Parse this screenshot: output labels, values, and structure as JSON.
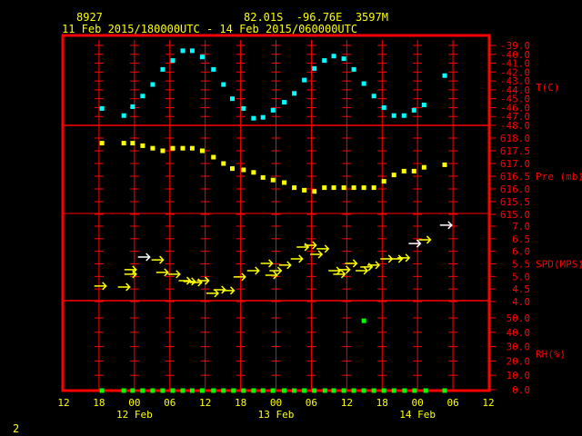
{
  "header": {
    "station_id": "8927",
    "location": "82.01S  -96.76E  3597M",
    "time_range": "11 Feb 2015/180000UTC - 14 Feb 2015/060000UTC"
  },
  "footer_number": "2",
  "colors": {
    "frame": "#ff0000",
    "temperature": "#00ffff",
    "pressure": "#ffff00",
    "wind": "#ffff00",
    "wind_alt": "#ffffff",
    "rh": "#00ff00",
    "text": "#ffff00"
  },
  "chart_data": {
    "type": "scatter",
    "title": "8927 82.01S -96.76E 3597M",
    "time_axis": {
      "unit": "hours since 11 Feb 2015 12UTC",
      "range": [
        0,
        72
      ],
      "tick_hours": [
        0,
        6,
        12,
        18,
        24,
        30,
        36,
        42,
        48,
        54,
        60,
        66,
        72
      ],
      "tick_labels": [
        "12",
        "18",
        "00",
        "06",
        "12",
        "18",
        "00",
        "06",
        "12",
        "18",
        "00",
        "06",
        "12"
      ],
      "day_labels": [
        {
          "hour": 12,
          "label": "12 Feb"
        },
        {
          "hour": 36,
          "label": "13 Feb"
        },
        {
          "hour": 60,
          "label": "14 Feb"
        }
      ]
    },
    "panels": [
      {
        "name": "temperature",
        "label": "T(C)",
        "range": [
          -48,
          -39
        ],
        "ticks": [
          "-39.0",
          "-40.0",
          "-41.0",
          "-42.0",
          "-43.0",
          "-44.0",
          "-45.0",
          "-46.0",
          "-47.0",
          "-48.0"
        ],
        "tick_values": [
          -39,
          -40,
          -41,
          -42,
          -43,
          -44,
          -45,
          -46,
          -47,
          -48
        ],
        "points": [
          [
            6.5,
            -46.1
          ],
          [
            10.2,
            -46.9
          ],
          [
            11.7,
            -45.9
          ],
          [
            13.4,
            -44.7
          ],
          [
            15.1,
            -43.4
          ],
          [
            16.8,
            -41.7
          ],
          [
            18.5,
            -40.7
          ],
          [
            20.2,
            -39.6
          ],
          [
            21.8,
            -39.6
          ],
          [
            23.5,
            -40.3
          ],
          [
            25.4,
            -41.7
          ],
          [
            27.1,
            -43.4
          ],
          [
            28.6,
            -45.0
          ],
          [
            30.5,
            -46.1
          ],
          [
            32.2,
            -47.2
          ],
          [
            33.8,
            -47.1
          ],
          [
            35.5,
            -46.3
          ],
          [
            37.4,
            -45.4
          ],
          [
            39.1,
            -44.4
          ],
          [
            40.8,
            -42.9
          ],
          [
            42.5,
            -41.6
          ],
          [
            44.2,
            -40.7
          ],
          [
            45.8,
            -40.2
          ],
          [
            47.5,
            -40.5
          ],
          [
            49.2,
            -41.7
          ],
          [
            50.9,
            -43.3
          ],
          [
            52.6,
            -44.7
          ],
          [
            54.3,
            -46.0
          ],
          [
            56.0,
            -46.9
          ],
          [
            57.7,
            -46.9
          ],
          [
            59.4,
            -46.3
          ],
          [
            61.1,
            -45.7
          ],
          [
            64.6,
            -42.4
          ]
        ]
      },
      {
        "name": "pressure",
        "label": "Pre (mb)",
        "range": [
          615,
          618
        ],
        "ticks": [
          "618.0",
          "617.5",
          "617.0",
          "616.5",
          "616.0",
          "615.5",
          "615.0"
        ],
        "tick_values": [
          618,
          617.5,
          617,
          616.5,
          616,
          615.5,
          615
        ],
        "points": [
          [
            6.5,
            617.8
          ],
          [
            10.2,
            617.8
          ],
          [
            11.7,
            617.8
          ],
          [
            13.4,
            617.7
          ],
          [
            15.1,
            617.6
          ],
          [
            16.8,
            617.5
          ],
          [
            18.5,
            617.6
          ],
          [
            20.2,
            617.6
          ],
          [
            21.8,
            617.6
          ],
          [
            23.5,
            617.5
          ],
          [
            25.4,
            617.25
          ],
          [
            27.1,
            617.0
          ],
          [
            28.6,
            616.8
          ],
          [
            30.5,
            616.75
          ],
          [
            32.2,
            616.65
          ],
          [
            33.8,
            616.45
          ],
          [
            35.5,
            616.35
          ],
          [
            37.4,
            616.25
          ],
          [
            39.1,
            616.05
          ],
          [
            40.8,
            615.95
          ],
          [
            42.5,
            615.9
          ],
          [
            44.2,
            616.05
          ],
          [
            45.8,
            616.05
          ],
          [
            47.5,
            616.05
          ],
          [
            49.2,
            616.05
          ],
          [
            50.9,
            616.05
          ],
          [
            52.6,
            616.05
          ],
          [
            54.3,
            616.3
          ],
          [
            56.0,
            616.55
          ],
          [
            57.7,
            616.7
          ],
          [
            59.4,
            616.7
          ],
          [
            61.1,
            616.85
          ],
          [
            64.6,
            616.95
          ]
        ]
      },
      {
        "name": "wind_speed",
        "label": "SPD(MPS)",
        "range": [
          4,
          7
        ],
        "ticks": [
          "7.0",
          "6.5",
          "6.0",
          "5.5",
          "5.0",
          "4.5",
          "4.0"
        ],
        "tick_values": [
          7,
          6.5,
          6,
          5.5,
          5,
          4.5,
          4
        ],
        "points": [
          [
            7.2,
            4.62
          ],
          [
            11.2,
            4.58
          ],
          [
            12.3,
            5.27
          ],
          [
            12.3,
            5.09
          ],
          [
            14.6,
            5.77
          ],
          [
            16.9,
            5.66
          ],
          [
            17.7,
            5.16
          ],
          [
            19.7,
            5.09
          ],
          [
            21.5,
            4.83
          ],
          [
            22.3,
            4.8
          ],
          [
            23.4,
            4.76
          ],
          [
            24.6,
            4.83
          ],
          [
            26.2,
            4.33
          ],
          [
            27.4,
            4.47
          ],
          [
            28.9,
            4.44
          ],
          [
            30.8,
            4.98
          ],
          [
            33.1,
            5.23
          ],
          [
            35.4,
            5.52
          ],
          [
            36.2,
            5.05
          ],
          [
            36.9,
            5.23
          ],
          [
            38.5,
            5.45
          ],
          [
            40.5,
            5.7
          ],
          [
            41.5,
            6.17
          ],
          [
            42.8,
            6.24
          ],
          [
            43.8,
            5.88
          ],
          [
            44.9,
            6.1
          ],
          [
            46.9,
            5.23
          ],
          [
            47.7,
            5.09
          ],
          [
            48.5,
            5.27
          ],
          [
            49.7,
            5.52
          ],
          [
            51.5,
            5.23
          ],
          [
            52.3,
            5.38
          ],
          [
            53.5,
            5.45
          ],
          [
            55.7,
            5.7
          ],
          [
            57.4,
            5.7
          ],
          [
            58.6,
            5.74
          ],
          [
            60.5,
            6.31
          ],
          [
            62.2,
            6.46
          ],
          [
            65.8,
            7.04
          ]
        ],
        "direction": "east"
      },
      {
        "name": "relative_humidity",
        "label": "RH(%)",
        "range": [
          0,
          50
        ],
        "ticks": [
          "50.0",
          "40.0",
          "30.0",
          "20.0",
          "10.0",
          "0.0"
        ],
        "tick_values": [
          50,
          40,
          30,
          20,
          10,
          0
        ],
        "points": [
          [
            6.5,
            0
          ],
          [
            10.2,
            0
          ],
          [
            11.7,
            0
          ],
          [
            13.4,
            0
          ],
          [
            15.1,
            0
          ],
          [
            16.8,
            0
          ],
          [
            18.5,
            0
          ],
          [
            20.2,
            0
          ],
          [
            21.8,
            0
          ],
          [
            23.5,
            0
          ],
          [
            25.4,
            0
          ],
          [
            27.1,
            0
          ],
          [
            28.8,
            0
          ],
          [
            30.5,
            0
          ],
          [
            32.2,
            0
          ],
          [
            33.8,
            0
          ],
          [
            35.5,
            0
          ],
          [
            37.4,
            0
          ],
          [
            39.1,
            0
          ],
          [
            40.8,
            0
          ],
          [
            42.5,
            0
          ],
          [
            44.3,
            0
          ],
          [
            45.8,
            0
          ],
          [
            47.5,
            0
          ],
          [
            49.2,
            0
          ],
          [
            50.9,
            0
          ],
          [
            50.9,
            48
          ],
          [
            52.6,
            0
          ],
          [
            54.3,
            0
          ],
          [
            56.0,
            0
          ],
          [
            57.8,
            0
          ],
          [
            59.5,
            0
          ],
          [
            61.4,
            0
          ],
          [
            64.6,
            0
          ]
        ]
      }
    ]
  }
}
